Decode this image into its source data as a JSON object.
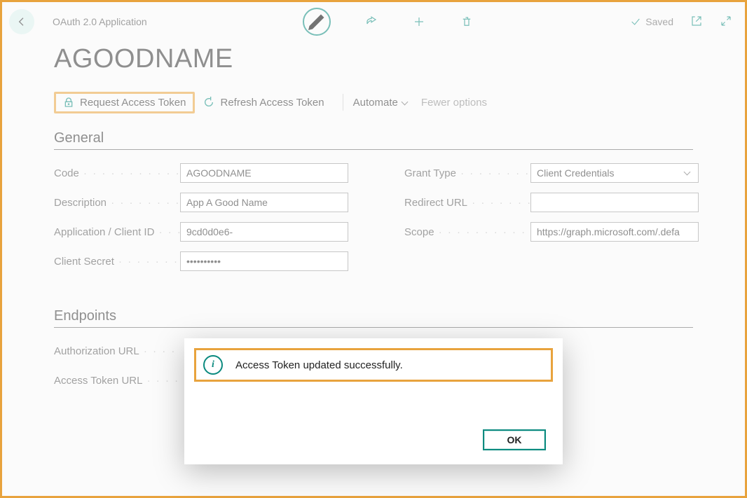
{
  "header": {
    "breadcrumb": "OAuth 2.0 Application",
    "saved_label": "Saved"
  },
  "page_title": "AGOODNAME",
  "actions": {
    "request_token": "Request Access Token",
    "refresh_token": "Refresh Access Token",
    "automate": "Automate",
    "fewer": "Fewer options"
  },
  "sections": {
    "general": {
      "heading": "General",
      "fields": {
        "code_label": "Code",
        "code_value": "AGOODNAME",
        "description_label": "Description",
        "description_value": "App A Good Name",
        "appclient_label": "Application / Client ID",
        "appclient_value": "9cd0d0e6-",
        "secret_label": "Client Secret",
        "secret_value": "••••••••••",
        "granttype_label": "Grant Type",
        "granttype_value": "Client Credentials",
        "redirect_label": "Redirect URL",
        "redirect_value": "",
        "scope_label": "Scope",
        "scope_value": "https://graph.microsoft.com/.defa"
      }
    },
    "endpoints": {
      "heading": "Endpoints",
      "fields": {
        "auth_url_label": "Authorization URL",
        "auth_url_value": "",
        "token_url_label": "Access Token URL",
        "token_url_value": ""
      }
    }
  },
  "dialog": {
    "message": "Access Token updated successfully.",
    "ok_label": "OK"
  },
  "icons": {
    "back": "back-arrow",
    "edit": "pencil",
    "share": "share",
    "add": "plus",
    "delete": "trash",
    "saved_check": "check",
    "popout": "popout",
    "expand": "expand",
    "lock": "lock-key",
    "refresh": "refresh"
  },
  "colors": {
    "accent": "#0b8a7f",
    "highlight": "#e8a33d"
  }
}
